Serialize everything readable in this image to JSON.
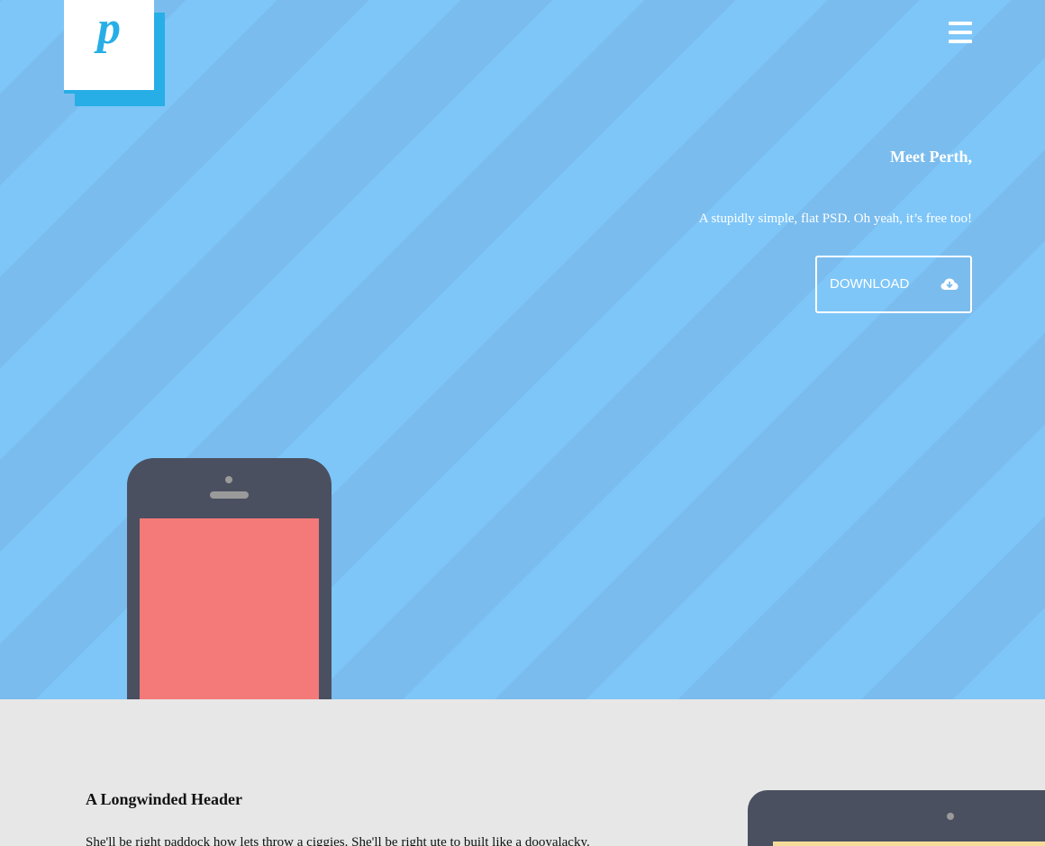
{
  "logo": {
    "letter": "p"
  },
  "nav": {
    "menu_icon": "hamburger-menu-icon"
  },
  "hero": {
    "title": "Meet Perth,",
    "subtitle": "A stupidly simple, flat PSD. Oh yeah, it’s free too!",
    "download_label": "DOWNLOAD",
    "download_icon": "cloud-download-icon"
  },
  "section": {
    "heading": "A Longwinded Header",
    "body": "She'll be right paddock how lets throw a ciggies. She'll be right ute to built like a dooyalacky."
  },
  "colors": {
    "stripe_light": "#7ec6f8",
    "stripe_dark": "#7bbcee",
    "logo_accent": "#27aee6",
    "device_body": "#4a5060",
    "phone_screen": "#f37a78",
    "tablet_screen": "#f5dc9a",
    "lower_bg": "#e7e7e7"
  }
}
